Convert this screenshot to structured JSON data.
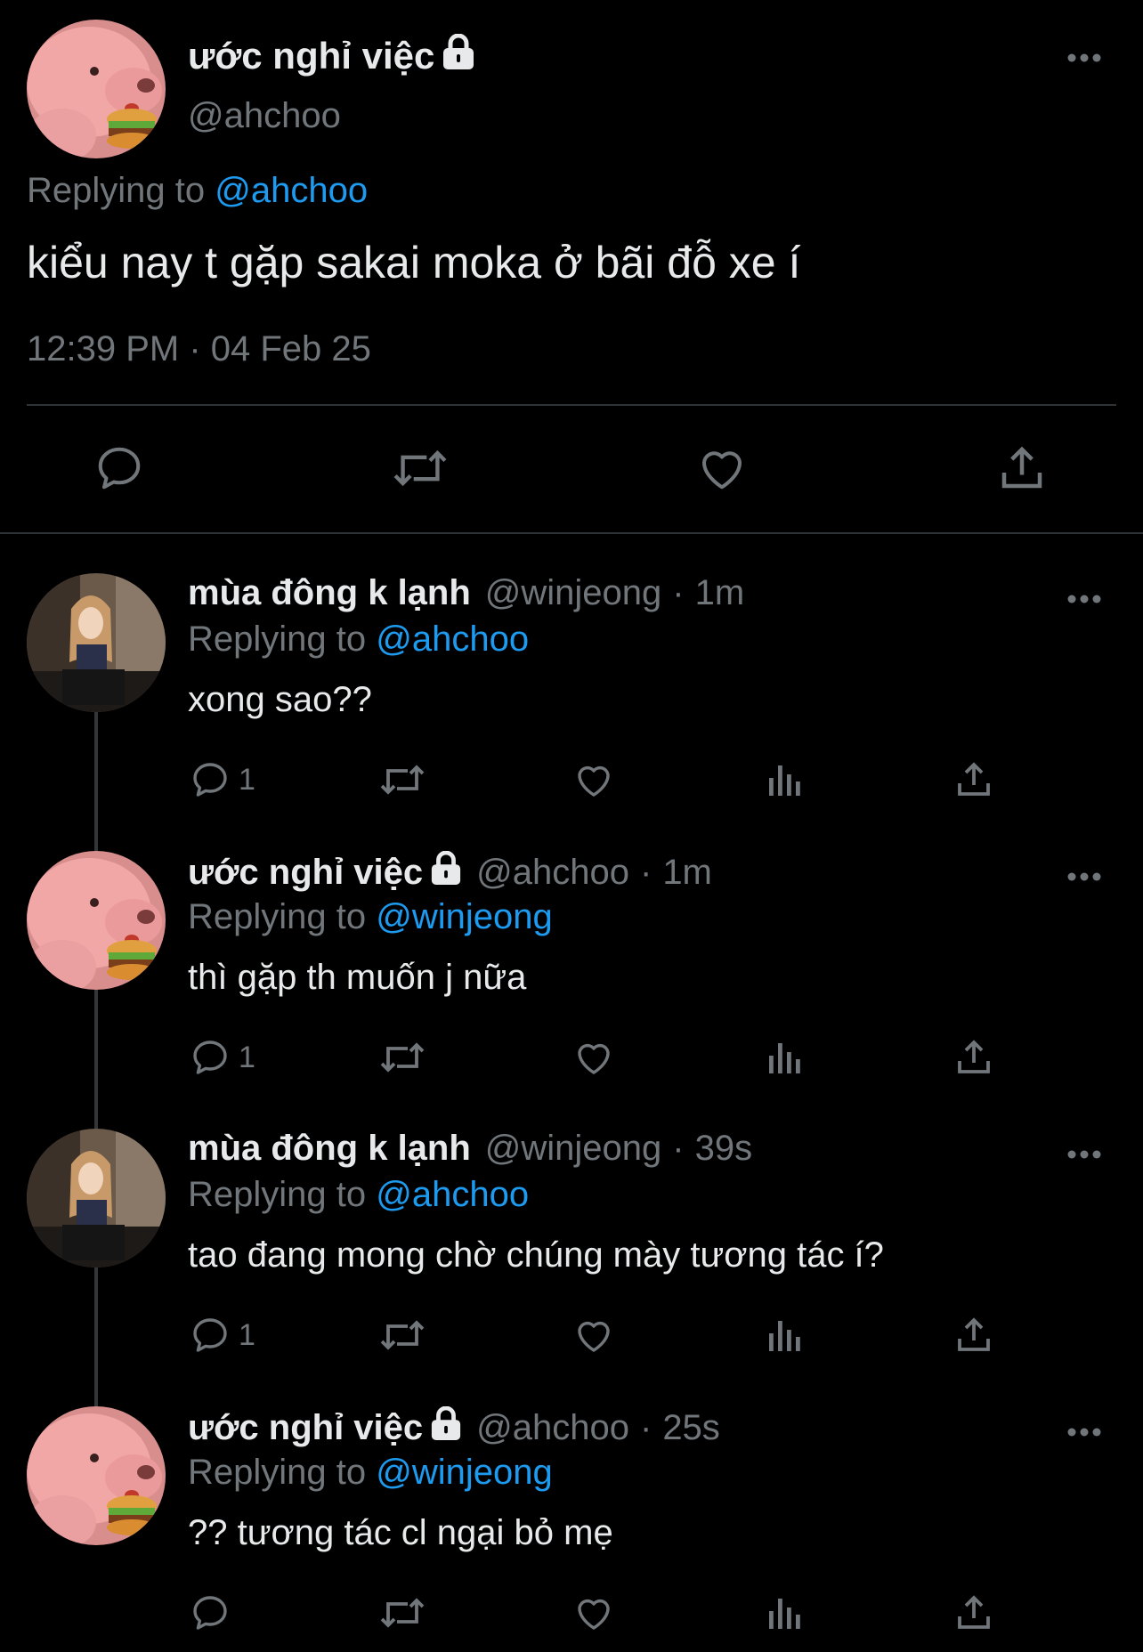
{
  "main_tweet": {
    "author_name": "ước nghỉ việc",
    "author_handle": "@ahchoo",
    "replying_prefix": "Replying to",
    "replying_to": "@ahchoo",
    "text": "kiểu nay t gặp sakai moka ở bãi đỗ xe í",
    "timestamp": "12:39 PM · 04 Feb 25",
    "actions": [
      "reply-icon",
      "retweet-icon",
      "like-icon",
      "share-icon"
    ]
  },
  "replies": [
    {
      "author_name": "mùa đông k lạnh",
      "author_handle": "@winjeong",
      "separator": "·",
      "time": "1m",
      "replying_prefix": "Replying to",
      "replying_to": "@ahchoo",
      "text": "xong sao??",
      "reply_count": "1",
      "locked": false
    },
    {
      "author_name": "ước nghỉ việc",
      "author_handle": "@ahchoo",
      "separator": "·",
      "time": "1m",
      "replying_prefix": "Replying to",
      "replying_to": "@winjeong",
      "text": "thì gặp th muốn j nữa",
      "reply_count": "1",
      "locked": true
    },
    {
      "author_name": "mùa đông k lạnh",
      "author_handle": "@winjeong",
      "separator": "·",
      "time": "39s",
      "replying_prefix": "Replying to",
      "replying_to": "@ahchoo",
      "text": "tao đang mong chờ chúng mày tương tác í?",
      "reply_count": "1",
      "locked": false
    },
    {
      "author_name": "ước nghỉ việc",
      "author_handle": "@ahchoo",
      "separator": "·",
      "time": "25s",
      "replying_prefix": "Replying to",
      "replying_to": "@winjeong",
      "text": "?? tương tác cl ngại bỏ mẹ",
      "reply_count": "",
      "locked": true
    }
  ],
  "colors": {
    "background": "#000000",
    "text_primary": "#e7e9ea",
    "text_secondary": "#71767b",
    "link": "#1d9bf0",
    "divider": "#2f3336"
  }
}
